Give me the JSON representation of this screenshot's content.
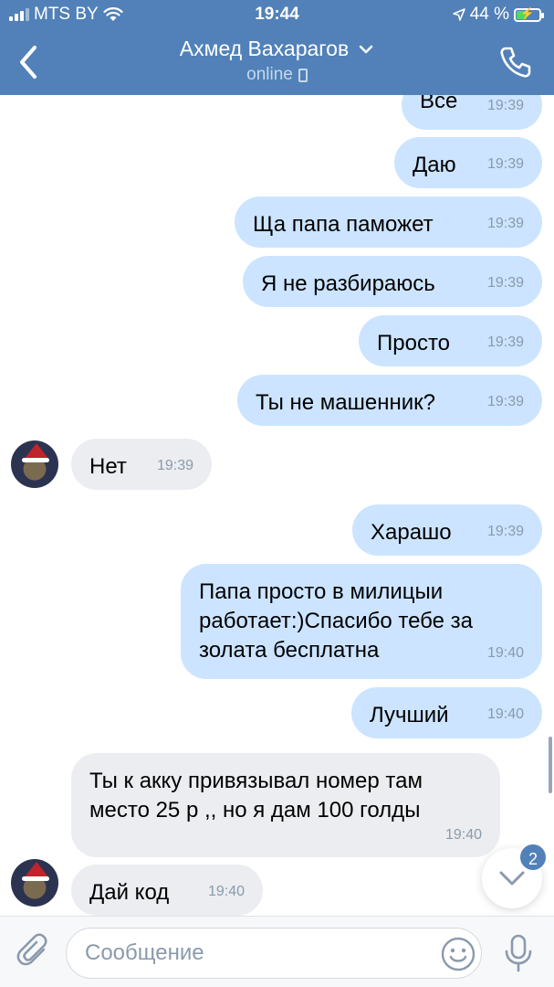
{
  "status_bar": {
    "carrier": "MTS BY",
    "time": "19:44",
    "battery": "44 %",
    "battery_level": 0.44
  },
  "header": {
    "contact_name": "Ахмед Вахарагов",
    "presence": "online",
    "icons": {
      "back": "chevron-left-icon",
      "title": "chevron-down-icon",
      "presence": "mobile-phone-icon",
      "call": "phone-call-icon"
    }
  },
  "messages": [
    {
      "dir": "out",
      "text": "Все",
      "time": "19:39"
    },
    {
      "dir": "out",
      "text": "Даю",
      "time": "19:39"
    },
    {
      "dir": "out",
      "text": "Ща папа паможет",
      "time": "19:39"
    },
    {
      "dir": "out",
      "text": "Я не разбираюсь",
      "time": "19:39"
    },
    {
      "dir": "out",
      "text": "Просто",
      "time": "19:39"
    },
    {
      "dir": "out",
      "text": "Ты не машенник?",
      "time": "19:39"
    },
    {
      "dir": "in",
      "text": "Нет",
      "time": "19:39"
    },
    {
      "dir": "out",
      "text": "Харашо",
      "time": "19:39"
    },
    {
      "dir": "out",
      "lines": [
        "Папа просто в милицыи",
        "работает:)Спасибо тебе за",
        "золата бесплатна"
      ],
      "time": "19:40"
    },
    {
      "dir": "out",
      "text": "Лучший",
      "time": "19:40"
    },
    {
      "dir": "in",
      "lines": [
        "Ты к акку привязывал номер там",
        "место 25 р ,, но я дам 100 голды"
      ],
      "time": "19:40"
    },
    {
      "dir": "in",
      "text": "Дай код",
      "time": "19:40"
    }
  ],
  "scroll_down": {
    "badge": "2"
  },
  "composer": {
    "placeholder": "Сообщение",
    "value": "",
    "icons": {
      "attach": "paperclip-icon",
      "emoji": "emoji-icon",
      "mic": "microphone-icon"
    }
  },
  "colors": {
    "header": "#5181b8",
    "outgoing_bubble": "#cce4ff",
    "incoming_bubble": "#ebedf0",
    "timestamp": "#8a9aac"
  }
}
